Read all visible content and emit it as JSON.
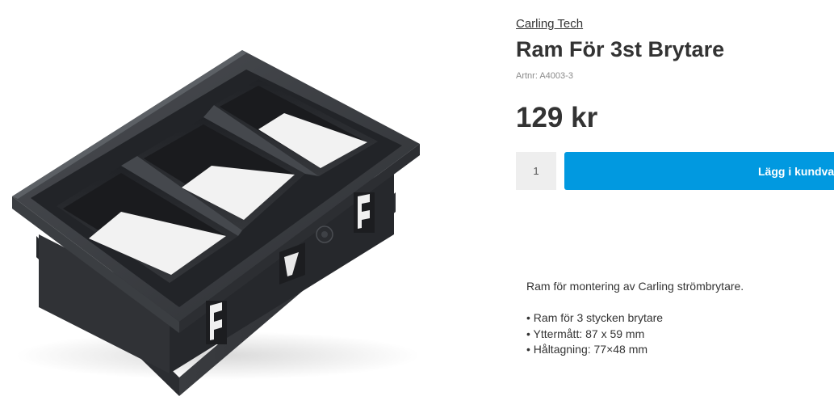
{
  "product": {
    "brand": "Carling Tech",
    "title": "Ram För 3st Brytare",
    "sku": "Artnr: A4003-3",
    "price": "129 kr",
    "quantity": "1",
    "add_to_cart_label": "Lägg i kundva",
    "description": "Ram för montering av Carling strömbrytare.",
    "features": [
      "• Ram för 3 stycken brytare",
      "• Yttermått: 87 x 59 mm",
      "• Håltagning: 77×48 mm"
    ]
  },
  "image": {
    "icon": "switch-frame-product-photo"
  },
  "colors": {
    "accent": "#0199e0",
    "text": "#333333",
    "muted": "#8a8a8a",
    "qty_bg": "#eeeeee"
  }
}
